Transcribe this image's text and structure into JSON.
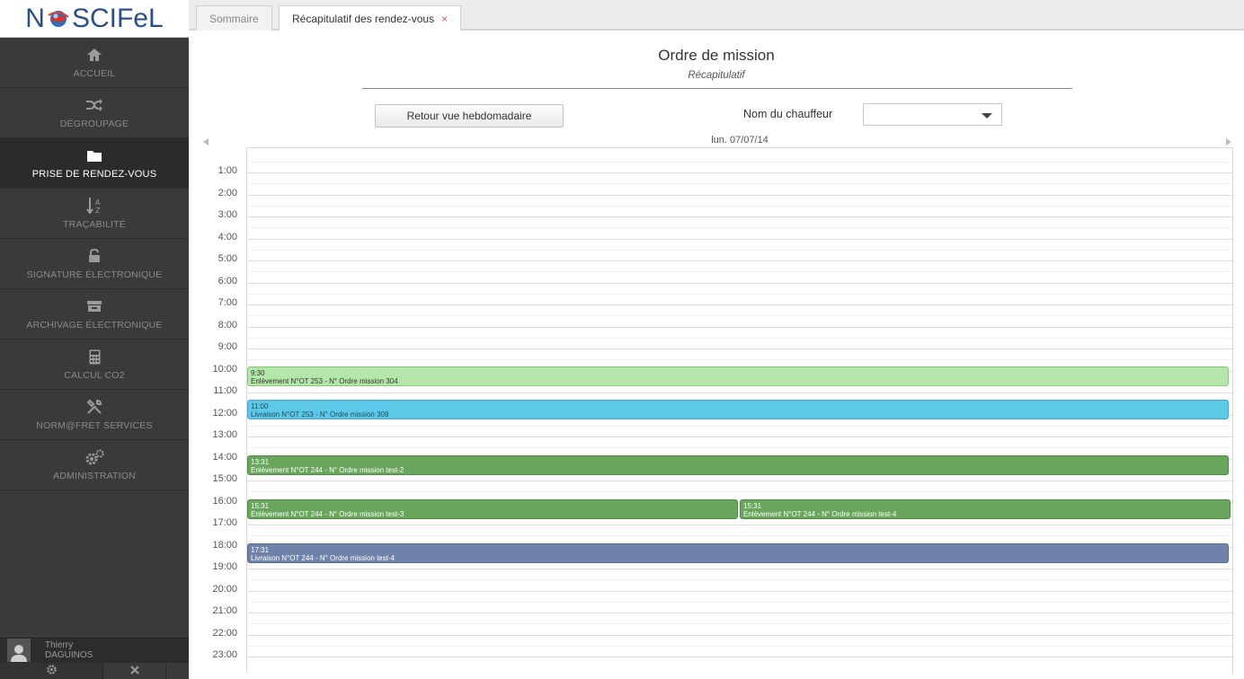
{
  "app": {
    "logo_n": "N",
    "logo_rest": "SCIFeL"
  },
  "sidebar": {
    "items": [
      {
        "label": "ACCUEIL",
        "icon": "home-icon"
      },
      {
        "label": "DÉGROUPAGE",
        "icon": "shuffle-icon"
      },
      {
        "label": "PRISE DE RENDEZ-VOUS",
        "icon": "folder-icon",
        "active": true
      },
      {
        "label": "TRAÇABILITÉ",
        "icon": "sort-az-icon"
      },
      {
        "label": "SIGNATURE ÉLECTRONIQUE",
        "icon": "unlock-icon"
      },
      {
        "label": "ARCHIVAGE ÉLECTRONIQUE",
        "icon": "archive-icon"
      },
      {
        "label": "CALCUL CO2",
        "icon": "calculator-icon"
      },
      {
        "label": "NORM@FRET SERVICES",
        "icon": "tools-icon"
      },
      {
        "label": "ADMINISTRATION",
        "icon": "gears-icon"
      }
    ],
    "user": {
      "first": "Thierry",
      "last": "DAGUINOS"
    }
  },
  "tabs": [
    {
      "label": "Sommaire"
    },
    {
      "label": "Récapitulatif des rendez-vous",
      "close": "×",
      "active": true
    }
  ],
  "page": {
    "title": "Ordre de mission",
    "subtitle": "Récapitulatif",
    "back_button": "Retour vue hebdomadaire",
    "driver_label": "Nom du chauffeur",
    "driver_value": ""
  },
  "calendar": {
    "day": "lun. 07/07/14",
    "hours": [
      "1:00",
      "2:00",
      "3:00",
      "4:00",
      "5:00",
      "6:00",
      "7:00",
      "8:00",
      "9:00",
      "10:00",
      "11:00",
      "12:00",
      "13:00",
      "14:00",
      "15:00",
      "16:00",
      "17:00",
      "18:00",
      "19:00",
      "20:00",
      "21:00",
      "22:00",
      "23:00"
    ],
    "events": [
      {
        "time": "9:30",
        "text": "Enlèvement N°OT 253 - N° Ordre mission 304",
        "color": "#b3e6a8",
        "border": "#88c97c",
        "fg": "#333333"
      },
      {
        "time": "11:00",
        "text": "Livraison N°OT 253 - N° Ordre mission 309",
        "color": "#5ec8e8",
        "border": "#3aa9cc",
        "fg": "#1d4a5c"
      },
      {
        "time": "13:31",
        "text": "Enlèvement N°OT 244 - N° Ordre mission test-2",
        "color": "#6aa55e",
        "border": "#4f8a45",
        "fg": "#ffffff"
      },
      {
        "time": "15:31",
        "text": "Enlèvement N°OT 244 - N° Ordre mission test-3",
        "color": "#6aa55e",
        "border": "#4f8a45",
        "fg": "#ffffff"
      },
      {
        "time": "15:31",
        "text": "Enlèvement N°OT 244 - N° Ordre mission test-4",
        "color": "#6aa55e",
        "border": "#4f8a45",
        "fg": "#ffffff"
      },
      {
        "time": "17:31",
        "text": "Livraison N°OT 244 - N° Ordre mission test-4",
        "color": "#6f82aa",
        "border": "#56698f",
        "fg": "#ffffff"
      }
    ]
  }
}
